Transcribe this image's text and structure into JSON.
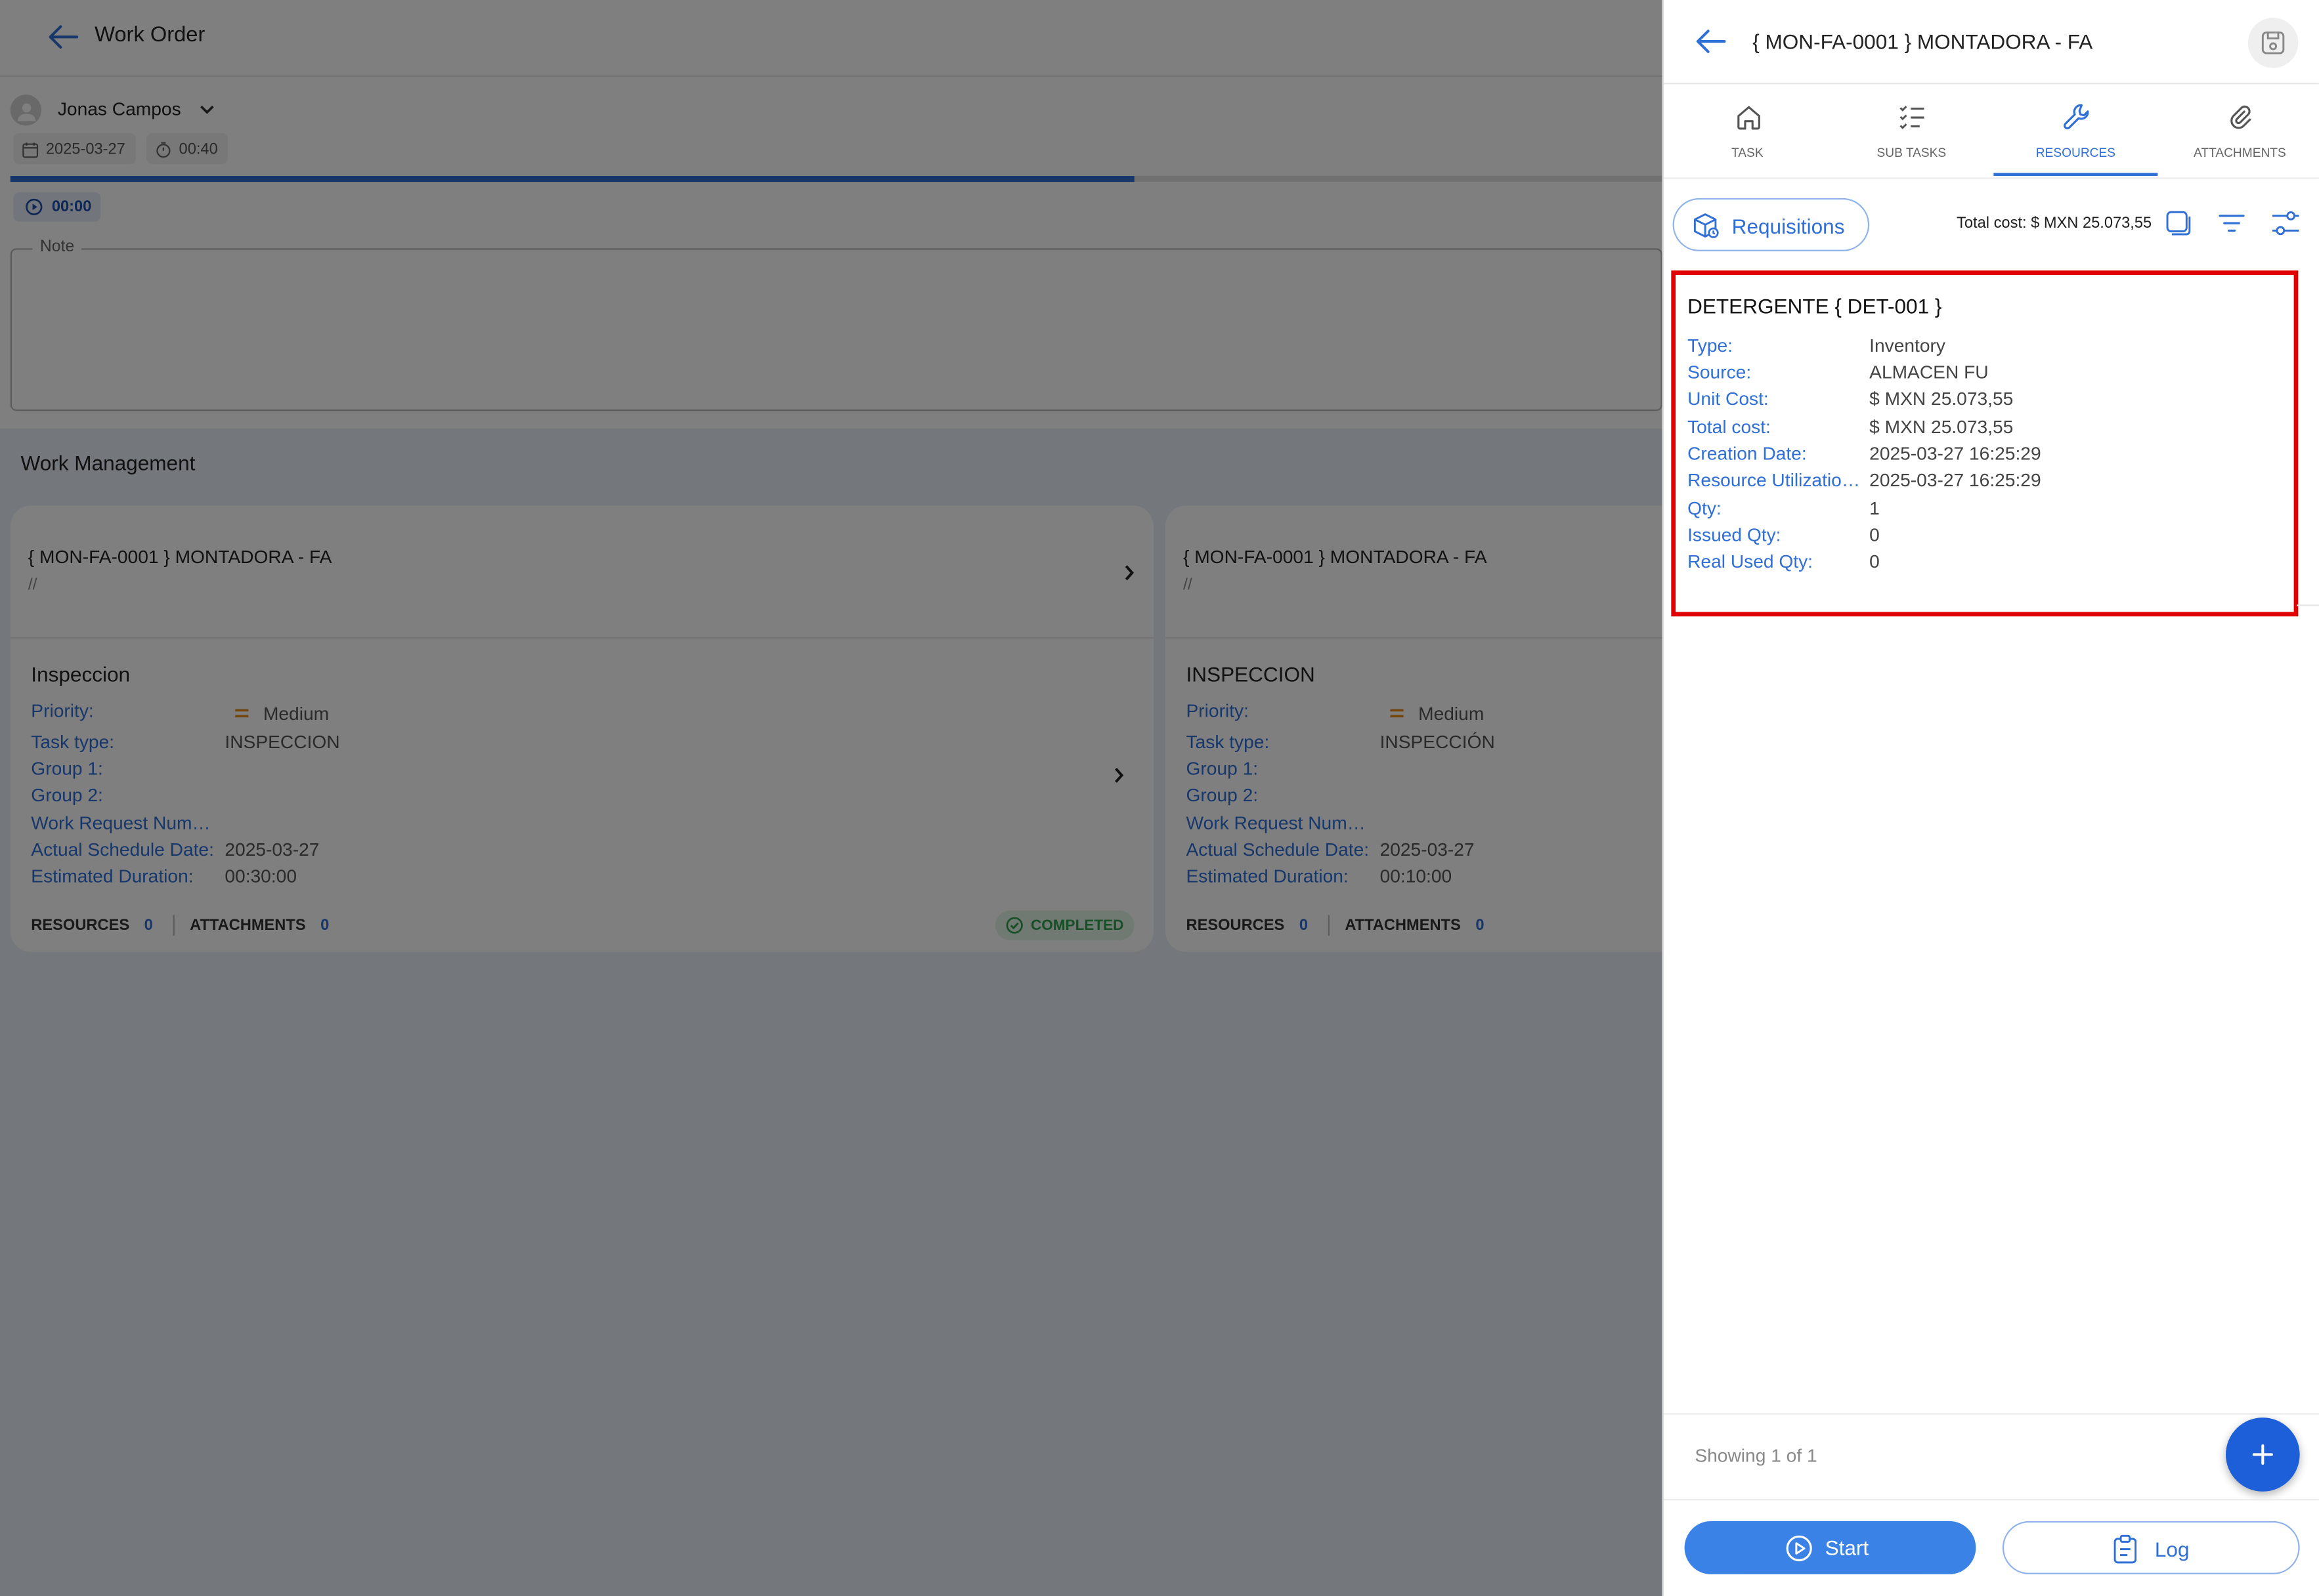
{
  "workorder": {
    "title": "Work Order",
    "user": "Jonas Campos",
    "date": "2025-03-27",
    "time": "00:40",
    "progress": 0.68,
    "timer": "00:00",
    "note_label": "Note",
    "section_title": "Work Management",
    "cards": [
      {
        "header": "{ MON-FA-0001 } MONTADORA - FA",
        "subline": "//",
        "title": "Inspeccion",
        "priority_label": "Priority:",
        "priority_value": "Medium",
        "task_type_label": "Task type:",
        "task_type_value": "INSPECCION",
        "group1_label": "Group 1:",
        "group2_label": "Group 2:",
        "wr_label": "Work Request Number:",
        "actual_label": "Actual Schedule Date:",
        "actual_value": "2025-03-27",
        "duration_label": "Estimated Duration:",
        "duration_value": "00:30:00",
        "resources_label": "RESOURCES",
        "resources_count": "0",
        "attachments_label": "ATTACHMENTS",
        "attachments_count": "0",
        "status": "COMPLETED"
      },
      {
        "header": "{ MON-FA-0001 } MONTADORA - FA",
        "subline": "//",
        "title": "INSPECCION",
        "priority_label": "Priority:",
        "priority_value": "Medium",
        "task_type_label": "Task type:",
        "task_type_value": "INSPECCIÓN",
        "group1_label": "Group 1:",
        "group2_label": "Group 2:",
        "wr_label": "Work Request Number:",
        "actual_label": "Actual Schedule Date:",
        "actual_value": "2025-03-27",
        "duration_label": "Estimated Duration:",
        "duration_value": "00:10:00",
        "resources_label": "RESOURCES",
        "resources_count": "0",
        "attachments_label": "ATTACHMENTS",
        "attachments_count": "0"
      }
    ]
  },
  "panel": {
    "title": "{ MON-FA-0001 } MONTADORA - FA",
    "tabs": [
      {
        "label": "TASK",
        "icon": "home-icon"
      },
      {
        "label": "SUB TASKS",
        "icon": "checklist-icon"
      },
      {
        "label": "RESOURCES",
        "icon": "wrench-icon",
        "active": true
      },
      {
        "label": "ATTACHMENTS",
        "icon": "paperclip-icon"
      }
    ],
    "requisitions_label": "Requisitions",
    "total_cost": "Total cost: $ MXN 25.073,55",
    "resource": {
      "name": "DETERGENTE { DET-001 }",
      "fields": [
        {
          "label": "Type:",
          "value": "Inventory"
        },
        {
          "label": "Source:",
          "value": "ALMACEN FU"
        },
        {
          "label": "Unit Cost:",
          "value": "$ MXN 25.073,55"
        },
        {
          "label": "Total cost:",
          "value": "$ MXN 25.073,55"
        },
        {
          "label": "Creation Date:",
          "value": "2025-03-27 16:25:29"
        },
        {
          "label": "Resource Utilization Date:",
          "value": "2025-03-27 16:25:29"
        },
        {
          "label": "Qty:",
          "value": "1"
        },
        {
          "label": "Issued Qty:",
          "value": "0"
        },
        {
          "label": "Real Used Qty:",
          "value": "0"
        }
      ]
    },
    "showing": "Showing 1 of 1",
    "start_label": "Start",
    "log_label": "Log",
    "colors": {
      "accent": "#2f6fd6",
      "primary_button": "#3b82e6",
      "fab": "#1c5fd8",
      "highlight": "#e00000",
      "completed": "#2e9e4f"
    }
  }
}
